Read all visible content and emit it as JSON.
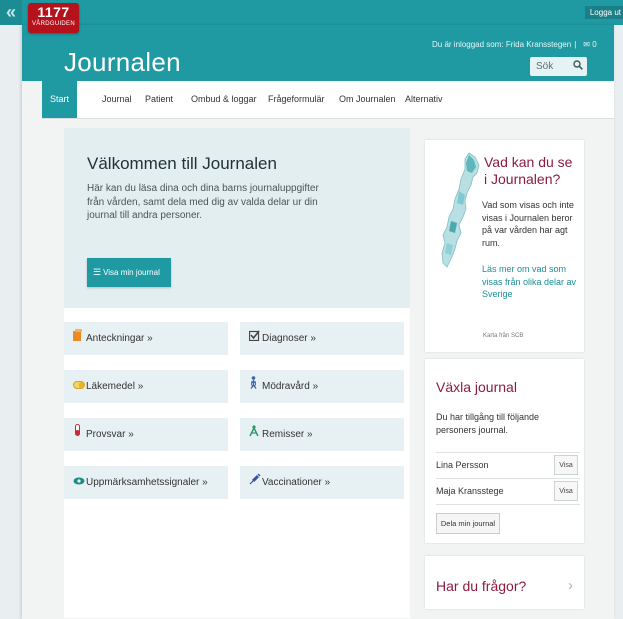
{
  "topbar": {
    "collapse_icon": "double-chevron-left-icon",
    "logo_number": "1177",
    "logo_text": "VÅRDGUIDEN",
    "logout_label": "Logga ut"
  },
  "header": {
    "title": "Journalen",
    "logged_in_prefix": "Du är inloggad som:",
    "user_name": "Frida Kransstegen",
    "separator": "|",
    "message_icon": "envelope-icon",
    "message_count": "0",
    "search_label": "Sök",
    "search_icon": "search-icon"
  },
  "nav": {
    "tabs": [
      {
        "label": "Start",
        "active": true
      },
      {
        "label": "Journal"
      },
      {
        "label": "Patient"
      },
      {
        "label": "Ombud & loggar"
      },
      {
        "label": "Frågeformulär"
      },
      {
        "label": "Om Journalen"
      },
      {
        "label": "Alternativ"
      }
    ]
  },
  "welcome": {
    "title": "Välkommen till Journalen",
    "text": "Här kan du läsa dina och dina barns journaluppgifter från vården, samt dela med dig av valda delar ur din journal till andra personer.",
    "button_icon": "list-icon",
    "button_label": "Visa min journal"
  },
  "cards": [
    {
      "label": "Anteckningar »",
      "icon": "notes-icon",
      "color": "#e98a22"
    },
    {
      "label": "Diagnoser »",
      "icon": "checkbox-icon",
      "color": "#444444"
    },
    {
      "label": "Läkemedel »",
      "icon": "pill-icon",
      "color": "#e0b52b"
    },
    {
      "label": "Mödravård »",
      "icon": "mother-icon",
      "color": "#3a64a8"
    },
    {
      "label": "Provsvar »",
      "icon": "test-tube-icon",
      "color": "#cc2a2a"
    },
    {
      "label": "Remisser »",
      "icon": "referral-icon",
      "color": "#2a9a6a"
    },
    {
      "label": "Uppmärksamhetssignaler »",
      "icon": "eye-icon",
      "color": "#1f8a86"
    },
    {
      "label": "Vaccinationer »",
      "icon": "syringe-icon",
      "color": "#3a50a8"
    }
  ],
  "info_box": {
    "title": "Vad kan du se i Journalen?",
    "text": "Vad som visas och inte visas i Journalen beror på var vården har agt rum.",
    "link": "Läs mer om vad som visas från olika delar av Sverige",
    "map_credit": "Karta från SCB",
    "map_icon": "sweden-map-icon"
  },
  "switch_box": {
    "title": "Växla journal",
    "text": "Du har tillgång till följande personers journal.",
    "persons": [
      {
        "name": "Lina Persson",
        "button": "Visa"
      },
      {
        "name": "Maja Kransstege",
        "button": "Visa"
      }
    ],
    "share_button": "Dela min journal"
  },
  "faq_box": {
    "title": "Har du frågor?",
    "chevron_icon": "chevron-right-icon"
  },
  "colors": {
    "teal": "#1f9aa2",
    "logo_red": "#b5121b",
    "heading_maroon": "#8c1c3d",
    "card_bg": "#e7f1f3"
  }
}
